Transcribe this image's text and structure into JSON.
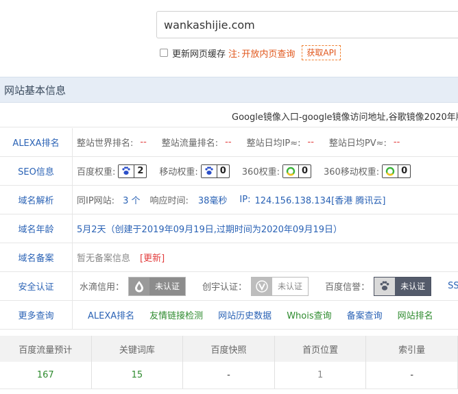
{
  "search": {
    "value": "wankashijie.com"
  },
  "options": {
    "cache_label": "更新网页缓存",
    "note": "注:",
    "note_link": "开放内页查询",
    "api_button": "获取API"
  },
  "section_title": "网站基本信息",
  "site_title": "Google镜像入口-google镜像访问地址,谷歌镜像2020年版",
  "alexa": {
    "label": "ALEXA排名",
    "world_rank_label": "整站世界排名:",
    "world_rank": "--",
    "traffic_rank_label": "整站流量排名:",
    "traffic_rank": "--",
    "daily_ip_label": "整站日均IP≈:",
    "daily_ip": "--",
    "daily_pv_label": "整站日均PV≈:",
    "daily_pv": "--"
  },
  "seo": {
    "label": "SEO信息",
    "baidu_label": "百度权重:",
    "baidu_value": "2",
    "mobile_label": "移动权重:",
    "mobile_value": "0",
    "w360_label": "360权重:",
    "w360_value": "0",
    "w360_mobile_label": "360移动权重:",
    "w360_mobile_value": "0"
  },
  "dns": {
    "label": "域名解析",
    "same_ip_label": "同IP网站:",
    "same_ip_value": "3 个",
    "response_label": "响应时间:",
    "response_value": "38毫秒",
    "ip_label": "IP:",
    "ip_value": "124.156.138.134[香港 腾讯云]"
  },
  "age": {
    "label": "域名年龄",
    "value": "5月2天（创建于2019年09月19日,过期时间为2020年09月19日）"
  },
  "icp": {
    "label": "域名备案",
    "value": "暂无备案信息",
    "update": "[更新]"
  },
  "security": {
    "label": "安全认证",
    "shuidi_label": "水滴信用：",
    "shuidi_badge": "未认证",
    "chuangyu_label": "创宇认证：",
    "chuangyu_badge": "未认证",
    "baidu_trust_label": "百度信誉：",
    "baidu_trust_badge": "未认证",
    "ssl_label": "SS"
  },
  "more": {
    "label": "更多查询",
    "links": [
      "ALEXA排名",
      "友情链接检测",
      "网站历史数据",
      "Whois查询",
      "备案查询",
      "网站排名"
    ]
  },
  "table": {
    "headers": [
      "百度流量预计",
      "关键词库",
      "百度快照",
      "首页位置",
      "索引量"
    ],
    "values": [
      "167",
      "15",
      "-",
      "1",
      "-"
    ]
  },
  "colors": {
    "link_blue": "#2a62b5",
    "accent_orange": "#e0561b",
    "warn_red": "#e23b3b",
    "link_green": "#2e8b2e",
    "header_bg": "#e6edf6"
  }
}
